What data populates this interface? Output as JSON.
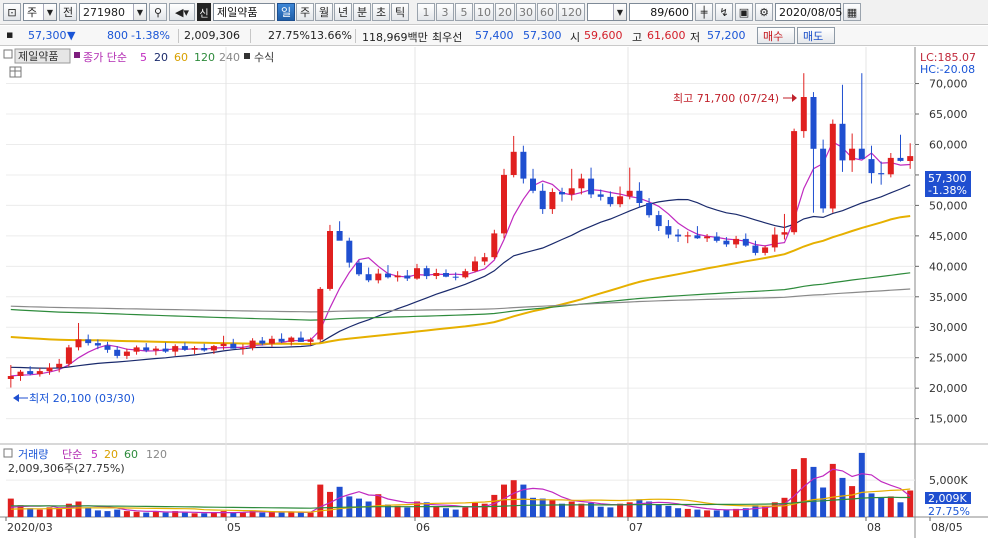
{
  "toolbar": {
    "market_type": "주",
    "prev_label": "전",
    "stock_code": "271980",
    "stock_flag": "신",
    "stock_name": "제일약품",
    "periods": [
      "일",
      "주",
      "월",
      "년",
      "분",
      "초",
      "틱"
    ],
    "active_period": "일",
    "intervals": [
      "1",
      "3",
      "5",
      "10",
      "20",
      "30",
      "60",
      "120"
    ],
    "count": "89/600",
    "date": "2020/08/05"
  },
  "quote": {
    "price": "57,300",
    "change": "800",
    "change_pct": "-1.38%",
    "volume": "2,009,306",
    "turnover_pct": "27.75%",
    "ratio_pct": "13.66%",
    "amount": "118,969백만",
    "best_ask_label": "최우선",
    "best_ask": "57,400",
    "best_bid": "57,300",
    "open_label": "시",
    "open": "59,600",
    "high_label": "고",
    "high": "61,600",
    "low_label": "저",
    "low": "57,200",
    "buy_label": "매수",
    "sell_label": "매도"
  },
  "legend": {
    "name": "제일약품",
    "series_label": "종가 단순",
    "ma": [
      "5",
      "20",
      "60",
      "120",
      "240"
    ],
    "formula": "수식",
    "lc": "LC:185.07",
    "hc": "HC:-20.08"
  },
  "volume_legend": {
    "label": "거래량",
    "series_label": "단순",
    "ma": [
      "5",
      "20",
      "60",
      "120"
    ],
    "value": "2,009,306주(27.75%)"
  },
  "annotations": {
    "high": "최고 71,700 (07/24)",
    "low": "최저 20,100 (03/30)",
    "last_price": "57,300",
    "last_change": "-1.38%",
    "last_volume": "2,009K",
    "last_turnover": "27.75%"
  },
  "colors": {
    "up": "#e0201f",
    "down": "#1f4fd0",
    "ma5": "#c02ac0",
    "ma20": "#1a2a6c",
    "ma60": "#e6b000",
    "ma120": "#2e8b3c",
    "ma240": "#8a8a8a"
  },
  "chart_data": {
    "type": "candlestick",
    "y_ticks": [
      "70,000",
      "65,000",
      "60,000",
      "55,000",
      "50,000",
      "45,000",
      "40,000",
      "35,000",
      "30,000",
      "25,000",
      "20,000",
      "15,000"
    ],
    "ylim": [
      11000,
      76000
    ],
    "x_labels": [
      "2020/03",
      "05",
      "06",
      "07",
      "08",
      "08/05"
    ],
    "volume_ticks": [
      "5,000K"
    ],
    "candles": [
      [
        21500,
        23800,
        20100,
        22000,
        2.5
      ],
      [
        22000,
        23000,
        21200,
        22700,
        1.6
      ],
      [
        22800,
        23600,
        22100,
        22300,
        1.2
      ],
      [
        22300,
        23300,
        21900,
        22800,
        1.0
      ],
      [
        22800,
        24100,
        22200,
        23400,
        1.3
      ],
      [
        23400,
        24800,
        22600,
        24000,
        1.1
      ],
      [
        24000,
        27100,
        23500,
        26700,
        1.8
      ],
      [
        26700,
        30700,
        26200,
        28000,
        2.1
      ],
      [
        28000,
        28800,
        27000,
        27400,
        1.3
      ],
      [
        27400,
        28000,
        26400,
        27000,
        0.9
      ],
      [
        27000,
        27600,
        25800,
        26300,
        0.8
      ],
      [
        26300,
        26900,
        24900,
        25300,
        1.0
      ],
      [
        25300,
        26500,
        24800,
        26000,
        0.8
      ],
      [
        26000,
        27000,
        25500,
        26700,
        0.7
      ],
      [
        26700,
        27400,
        25900,
        26200,
        0.6
      ],
      [
        26200,
        26900,
        25400,
        26500,
        0.7
      ],
      [
        26500,
        27500,
        25800,
        26000,
        0.6
      ],
      [
        26000,
        27200,
        25300,
        26900,
        0.8
      ],
      [
        26900,
        27500,
        26100,
        26300,
        0.6
      ],
      [
        26300,
        26900,
        25600,
        26600,
        0.5
      ],
      [
        26600,
        27300,
        26000,
        26200,
        0.5
      ],
      [
        26200,
        27100,
        25600,
        26900,
        0.6
      ],
      [
        26900,
        28600,
        26300,
        27300,
        0.8
      ],
      [
        27300,
        28100,
        26500,
        26500,
        0.6
      ],
      [
        26500,
        27200,
        25500,
        26600,
        0.6
      ],
      [
        26600,
        28200,
        26200,
        27800,
        0.9
      ],
      [
        27800,
        28400,
        27000,
        27300,
        0.6
      ],
      [
        27300,
        28600,
        26800,
        28100,
        0.7
      ],
      [
        28100,
        29000,
        27400,
        27600,
        0.6
      ],
      [
        27600,
        28500,
        27000,
        28300,
        0.7
      ],
      [
        28300,
        29300,
        27600,
        27600,
        0.6
      ],
      [
        27600,
        28300,
        27000,
        28000,
        0.6
      ],
      [
        28000,
        36600,
        27600,
        36300,
        4.4
      ],
      [
        36300,
        46800,
        36000,
        45800,
        3.4
      ],
      [
        45800,
        47400,
        44400,
        44200,
        4.1
      ],
      [
        44200,
        44700,
        39800,
        40600,
        2.8
      ],
      [
        40600,
        41000,
        38400,
        38700,
        2.5
      ],
      [
        38700,
        39800,
        37400,
        37700,
        2.1
      ],
      [
        37700,
        39600,
        37200,
        38800,
        3.1
      ],
      [
        38800,
        40200,
        38000,
        38200,
        1.7
      ],
      [
        38200,
        39200,
        37500,
        38500,
        1.5
      ],
      [
        38500,
        39400,
        37600,
        38000,
        1.3
      ],
      [
        38000,
        40400,
        37800,
        39700,
        2.1
      ],
      [
        39700,
        40100,
        37900,
        38400,
        2.0
      ],
      [
        38400,
        39600,
        37900,
        38900,
        1.4
      ],
      [
        38900,
        39500,
        38200,
        38300,
        1.2
      ],
      [
        38300,
        39000,
        37700,
        38200,
        1.0
      ],
      [
        38200,
        39600,
        38000,
        39200,
        1.3
      ],
      [
        39200,
        41600,
        39000,
        40800,
        1.9
      ],
      [
        40800,
        42200,
        40200,
        41500,
        1.8
      ],
      [
        41500,
        46000,
        41200,
        45400,
        3.0
      ],
      [
        45400,
        56000,
        44600,
        55000,
        4.4
      ],
      [
        55000,
        61400,
        54600,
        58800,
        5.0
      ],
      [
        58800,
        59800,
        53600,
        54400,
        4.4
      ],
      [
        54400,
        56000,
        52000,
        52400,
        2.6
      ],
      [
        52400,
        53600,
        48600,
        49400,
        2.5
      ],
      [
        49400,
        52800,
        48600,
        52200,
        2.3
      ],
      [
        52200,
        52900,
        50600,
        51800,
        1.8
      ],
      [
        51800,
        56000,
        50800,
        52800,
        2.1
      ],
      [
        52800,
        55200,
        51800,
        54400,
        1.8
      ],
      [
        54400,
        56200,
        51200,
        51800,
        1.9
      ],
      [
        51800,
        52600,
        50800,
        51400,
        1.4
      ],
      [
        51400,
        52300,
        49800,
        50200,
        1.3
      ],
      [
        50200,
        53100,
        49700,
        51500,
        1.8
      ],
      [
        51500,
        56200,
        51000,
        52400,
        2.0
      ],
      [
        52400,
        53800,
        49600,
        50400,
        2.4
      ],
      [
        50400,
        51200,
        48000,
        48400,
        2.1
      ],
      [
        48400,
        49100,
        45800,
        46600,
        1.7
      ],
      [
        46600,
        47600,
        44600,
        45200,
        1.5
      ],
      [
        45200,
        46100,
        44000,
        44900,
        1.2
      ],
      [
        44900,
        45700,
        43800,
        45100,
        1.1
      ],
      [
        45100,
        46600,
        44500,
        44600,
        1.0
      ],
      [
        44600,
        45300,
        44000,
        44900,
        0.9
      ],
      [
        44900,
        45600,
        43900,
        44200,
        0.9
      ],
      [
        44200,
        44800,
        43200,
        43600,
        1.0
      ],
      [
        43600,
        45000,
        43000,
        44500,
        1.1
      ],
      [
        44500,
        45400,
        43200,
        43400,
        1.2
      ],
      [
        43400,
        44200,
        41800,
        42200,
        1.6
      ],
      [
        42200,
        43400,
        41800,
        43100,
        1.5
      ],
      [
        43100,
        46400,
        42400,
        45200,
        2.0
      ],
      [
        45200,
        48600,
        44400,
        45600,
        2.6
      ],
      [
        45600,
        62600,
        45200,
        62200,
        6.5
      ],
      [
        62200,
        71700,
        61100,
        67800,
        8.0
      ],
      [
        67800,
        68600,
        48800,
        59300,
        6.8
      ],
      [
        59300,
        60800,
        48800,
        49500,
        4.0
      ],
      [
        49500,
        64100,
        48800,
        63400,
        7.2
      ],
      [
        63400,
        69800,
        55500,
        57400,
        5.3
      ],
      [
        57400,
        61800,
        55500,
        59300,
        4.2
      ],
      [
        59300,
        71700,
        58100,
        57600,
        8.7
      ],
      [
        57600,
        59800,
        53600,
        55300,
        3.2
      ],
      [
        55300,
        57200,
        53400,
        55100,
        2.6
      ],
      [
        55100,
        58600,
        54600,
        57800,
        2.8
      ],
      [
        57800,
        61600,
        57200,
        57300,
        2.0
      ],
      [
        57300,
        60200,
        56000,
        58100,
        3.6
      ]
    ]
  }
}
